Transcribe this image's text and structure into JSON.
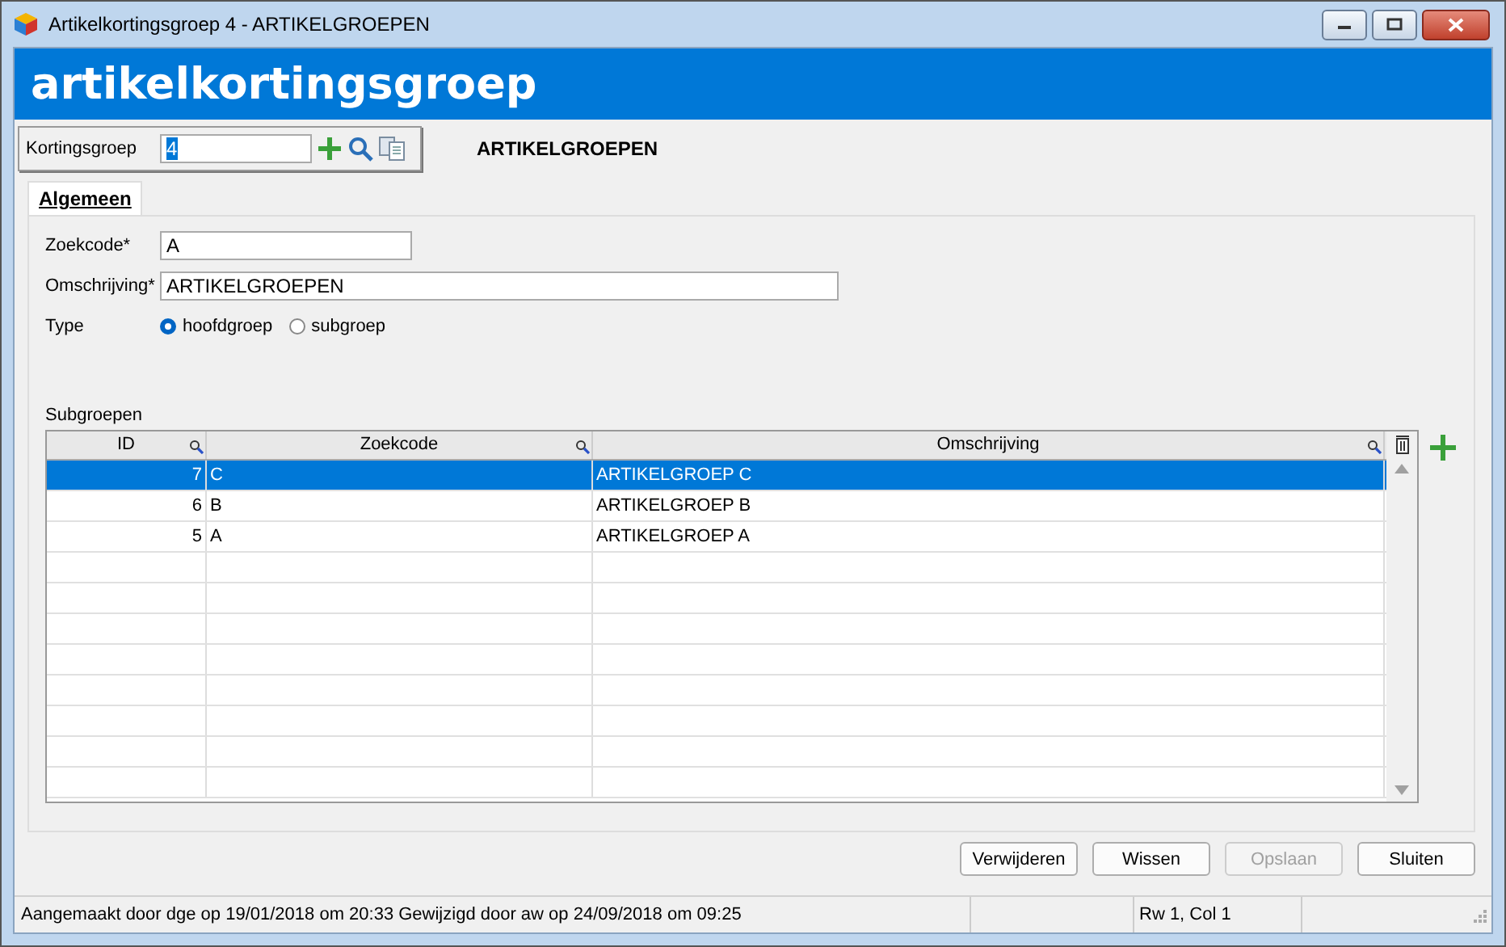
{
  "window": {
    "title": "Artikelkortingsgroep 4 - ARTIKELGROEPEN"
  },
  "header": {
    "title": "artikelkortingsgroep"
  },
  "toolbar": {
    "label": "Kortingsgroep",
    "value": "4",
    "caption": "ARTIKELGROEPEN"
  },
  "tabs": [
    {
      "label": "Algemeen",
      "selected": true
    }
  ],
  "fields": [
    {
      "label": "Zoekcode*",
      "value": "A",
      "kind": "short"
    },
    {
      "label": "Omschrijving*",
      "value": "ARTIKELGROEPEN",
      "kind": "long"
    }
  ],
  "type": {
    "label": "Type",
    "options": [
      {
        "label": "hoofdgroep",
        "selected": true
      },
      {
        "label": "subgroep",
        "selected": false
      }
    ]
  },
  "table": {
    "title": "Subgroepen",
    "columns": [
      "ID",
      "Zoekcode",
      "Omschrijving"
    ],
    "rows": [
      {
        "id": "7",
        "code": "C",
        "name": "ARTIKELGROEP C",
        "selected": true
      },
      {
        "id": "6",
        "code": "B",
        "name": "ARTIKELGROEP B",
        "selected": false
      },
      {
        "id": "5",
        "code": "A",
        "name": "ARTIKELGROEP A",
        "selected": false
      }
    ]
  },
  "buttons": [
    {
      "label": "Verwijderen",
      "disabled": false
    },
    {
      "label": "Wissen",
      "disabled": false
    },
    {
      "label": "Opslaan",
      "disabled": true
    },
    {
      "label": "Sluiten",
      "disabled": false
    }
  ],
  "status_bar": {
    "info": "Aangemaakt door dge op 19/01/2018 om 20:33  Gewijzigd door aw op 24/09/2018 om 09:25",
    "position": "Rw 1, Col 1"
  }
}
